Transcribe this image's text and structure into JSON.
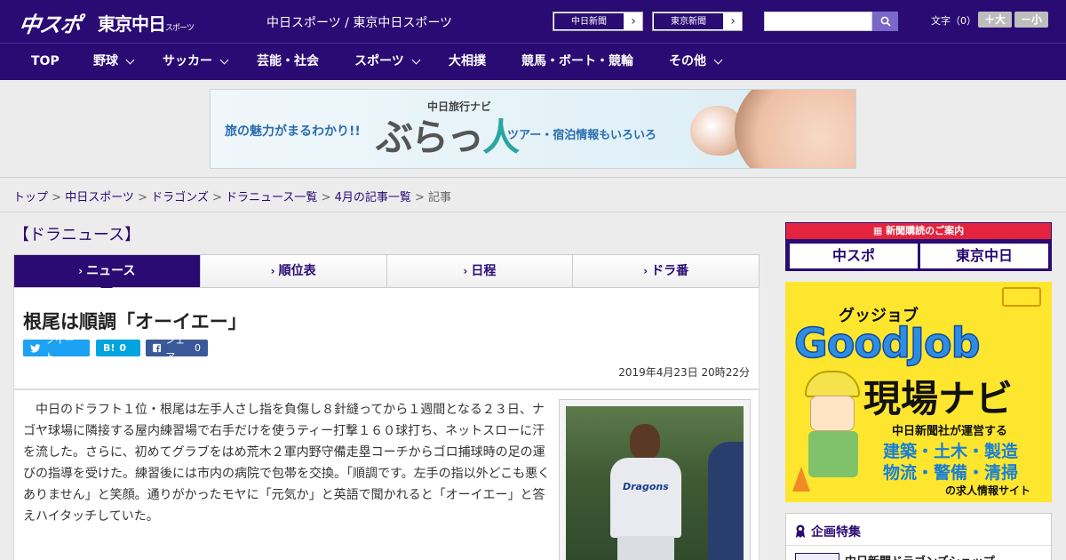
{
  "header": {
    "logo_chuspo": "中スポ",
    "logo_tokyo": "東京中日",
    "logo_tokyo_sub": "スポーツ",
    "site_name": "中日スポーツ / 東京中日スポーツ",
    "paper_links": [
      "中日新聞",
      "東京新聞"
    ],
    "search": {
      "placeholder": ""
    },
    "font_size_label": "文字（0）",
    "font_larger": "＋大",
    "font_smaller": "－小"
  },
  "nav": {
    "items": [
      {
        "label": "TOP",
        "has_menu": false
      },
      {
        "label": "野球",
        "has_menu": true
      },
      {
        "label": "サッカー",
        "has_menu": true
      },
      {
        "label": "芸能・社会",
        "has_menu": false
      },
      {
        "label": "スポーツ",
        "has_menu": true
      },
      {
        "label": "大相撲",
        "has_menu": false
      },
      {
        "label": "競馬・ボート・競輪",
        "has_menu": false
      },
      {
        "label": "その他",
        "has_menu": true
      }
    ]
  },
  "banner": {
    "lead": "旅の魅力がまるわかり!!",
    "subtitle": "中日旅行ナビ",
    "logo_kana": "ぶらっ",
    "logo_kanji": "人",
    "tail": "ツアー・宿泊情報もいろいろ"
  },
  "breadcrumb": {
    "items": [
      "トップ",
      "中日スポーツ",
      "ドラゴンズ",
      "ドラニュース一覧",
      "4月の記事一覧"
    ],
    "current": "記事",
    "separator": " > "
  },
  "section": {
    "title": "【ドラニュース】"
  },
  "tabs": [
    {
      "label": "ニュース",
      "active": true
    },
    {
      "label": "順位表",
      "active": false
    },
    {
      "label": "日程",
      "active": false
    },
    {
      "label": "ドラ番",
      "active": false
    }
  ],
  "article": {
    "headline": "根尾は順調「オーイエー」",
    "share": {
      "tweet_label": "ツイート",
      "hatena_count": "0",
      "facebook_label": "シェア",
      "facebook_count": "0"
    },
    "date": "2019年4月23日 20時22分",
    "body": "中日のドラフト１位・根尾は左手人さし指を負傷し８針縫ってから１週間となる２３日、ナゴヤ球場に隣接する屋内練習場で右手だけを使うティー打撃１６０球打ち、ネットスローに汗を流した。さらに、初めてグラブをはめ荒木２軍内野守備走塁コーチからゴロ捕球時の足の運びの指導を受けた。練習後には市内の病院で包帯を交換。「順調です。左手の指以外どこも悪くありません」と笑顔。通りがかったモヤに「元気か」と英語で聞かれると「オーイエー」と答えハイタッチしていた。",
    "photo_jersey_text": "Dragons"
  },
  "sidebar": {
    "subscribe_title": "新聞購読のご案内",
    "subscribe_logos": [
      "中スポ",
      "東京中日"
    ],
    "goodjob": {
      "kana": "グッジョブ",
      "title": "GoodJob",
      "subtitle": "現場ナビ",
      "line1": "中日新聞社が運営する",
      "line2": "建築・土木・製造",
      "line3": "物流・警備・清掃",
      "line4": "の求人情報サイト"
    },
    "feature": {
      "title": "企画特集",
      "item": "中日新聞ドラゴンズショップ"
    }
  },
  "colors": {
    "brand": "#2a0a73",
    "accent_red": "#e4243e",
    "twitter": "#1da1f2",
    "hatena": "#00a4de",
    "facebook": "#3b5998"
  }
}
